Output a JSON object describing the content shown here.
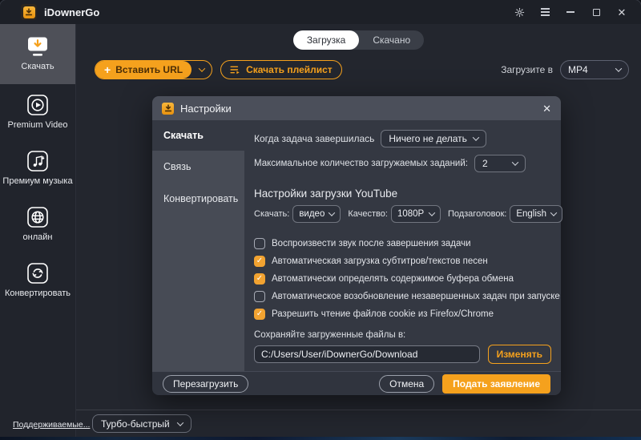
{
  "colors": {
    "accent": "#f5a11d",
    "checkbox_checked": "#f2a331",
    "dialog_bg": "#343842"
  },
  "window": {
    "title": "iDownerGo",
    "controls": {
      "settings": "gear-icon",
      "menu": "menu-icon",
      "minimize": "minimize-icon",
      "maximize": "maximize-icon",
      "close": "close-icon"
    }
  },
  "sidebar": {
    "items": [
      {
        "label": "Скачать",
        "icon": "monitor-download-icon",
        "active": true
      },
      {
        "label": "Premium Video",
        "icon": "play-icon",
        "active": false
      },
      {
        "label": "Премиум музыка",
        "icon": "music-download-icon",
        "active": false
      },
      {
        "label": "онлайн",
        "icon": "globe-icon",
        "active": false
      },
      {
        "label": "Конвертировать",
        "icon": "convert-arrows-icon",
        "active": false
      }
    ],
    "supported_link": "Поддерживаемые..."
  },
  "tabs": {
    "download": "Загрузка",
    "downloaded": "Скачано"
  },
  "toolbar": {
    "paste_plus": "+",
    "paste_url": "Вставить URL",
    "download_playlist": "Скачать плейлист",
    "download_to_label": "Загрузите в",
    "format_value": "MP4"
  },
  "bottom": {
    "speed_mode": "Турбо-быстрый"
  },
  "dialog": {
    "title": "Настройки",
    "close": "✕",
    "nav": [
      {
        "label": "Скачать",
        "active": true
      },
      {
        "label": "Связь",
        "active": false
      },
      {
        "label": "Конвертировать",
        "active": false
      }
    ],
    "task_finished_label": "Когда задача завершилась",
    "task_finished_value": "Ничего не делать",
    "max_downloads_label": "Максимальное количество загружаемых заданий:",
    "max_downloads_value": "2",
    "youtube": {
      "heading": "Настройки загрузки YouTube",
      "download_label": "Скачать:",
      "download_value": "видео",
      "quality_label": "Качество:",
      "quality_value": "1080P",
      "subtitle_label": "Подзаголовок:",
      "subtitle_value": "English"
    },
    "checkboxes": [
      {
        "label": "Воспроизвести звук после завершения задачи",
        "checked": false
      },
      {
        "label": "Автоматическая загрузка субтитров/текстов песен",
        "checked": true
      },
      {
        "label": "Автоматически определять содержимое буфера обмена",
        "checked": true
      },
      {
        "label": "Автоматическое возобновление незавершенных задач при запуске",
        "checked": false
      },
      {
        "label": "Разрешить чтение файлов cookie из Firefox/Chrome",
        "checked": true
      }
    ],
    "save_path_label": "Сохраняйте загруженные файлы в:",
    "save_path_value": "C:/Users/User/iDownerGo/Download",
    "change_button": "Изменять",
    "footer": {
      "reload": "Перезагрузить",
      "cancel": "Отмена",
      "apply": "Подать заявление"
    }
  }
}
